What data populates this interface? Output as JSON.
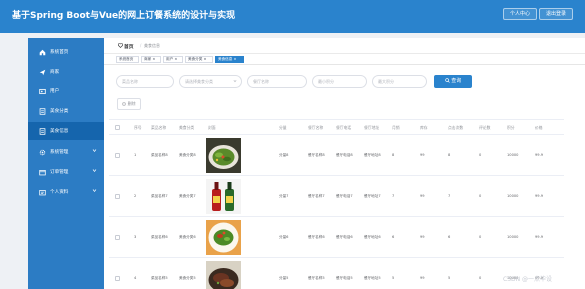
{
  "header": {
    "title": "基于Spring Boot与Vue的网上订餐系统的设计与实现",
    "center_label": "个人中心",
    "logout_label": "退出登录"
  },
  "sidebar": {
    "items": [
      {
        "label": "系统首页",
        "icon": "home-icon"
      },
      {
        "label": "商家",
        "icon": "send-icon"
      },
      {
        "label": "用户",
        "icon": "user-icon"
      },
      {
        "label": "美食分类",
        "icon": "list-icon"
      },
      {
        "label": "美食信息",
        "icon": "list-icon",
        "active": true
      },
      {
        "label": "系统管理",
        "icon": "gear-icon",
        "expandable": true
      },
      {
        "label": "订单管理",
        "icon": "cart-icon",
        "expandable": true
      },
      {
        "label": "个人资料",
        "icon": "card-icon",
        "expandable": true
      }
    ]
  },
  "breadcrumb": {
    "home": "首页",
    "separator": "/",
    "current": "美食信息"
  },
  "tags": [
    {
      "label": "系统首页"
    },
    {
      "label": "商家 ×"
    },
    {
      "label": "用户 ×"
    },
    {
      "label": "美食分类 ×"
    },
    {
      "label": "美食信息 ×",
      "active": true
    }
  ],
  "search": {
    "fields": [
      {
        "placeholder": "菜品名称"
      },
      {
        "placeholder": "请选择美食分类",
        "dropdown": true
      },
      {
        "placeholder": "餐厅名称"
      },
      {
        "placeholder": "最小积分"
      },
      {
        "placeholder": "最大积分"
      }
    ],
    "query_label": "查询"
  },
  "delete_label": "删除",
  "table": {
    "columns": [
      "序号",
      "菜品名称",
      "美食分类",
      "封面",
      "分量",
      "餐厅名称",
      "餐厅电话",
      "餐厅地址",
      "月销",
      "库存",
      "点击次数",
      "评论数",
      "积分",
      "价格"
    ],
    "rows": [
      {
        "cells": [
          "1",
          "菜品名称8",
          "美食分类8",
          "",
          "分量8",
          "餐厅名称8",
          "餐厅电话8",
          "餐厅地址8",
          "8",
          "99",
          "8",
          "0",
          "10000",
          "99.9"
        ],
        "image": "dish-greens"
      },
      {
        "cells": [
          "2",
          "菜品名称7",
          "美食分类7",
          "",
          "分量7",
          "餐厅名称7",
          "餐厅电话7",
          "餐厅地址7",
          "7",
          "99",
          "7",
          "0",
          "10000",
          "99.9"
        ],
        "image": "bottles"
      },
      {
        "cells": [
          "3",
          "菜品名称6",
          "美食分类6",
          "",
          "分量6",
          "餐厅名称6",
          "餐厅电话6",
          "餐厅地址6",
          "6",
          "99",
          "6",
          "0",
          "10000",
          "99.9"
        ],
        "image": "dish-plate"
      },
      {
        "cells": [
          "4",
          "菜品名称5",
          "美食分类5",
          "",
          "分量5",
          "餐厅名称5",
          "餐厅电话5",
          "餐厅地址5",
          "5",
          "99",
          "5",
          "0",
          "10000",
          "99.9"
        ],
        "image": "dish-meat"
      }
    ]
  },
  "watermark": "CSDN @一点毕设",
  "colors": {
    "header": "#2a83cd",
    "sidebar": "#2c7cc4",
    "sidebar_active": "#1565ad",
    "accent": "#2a83cd"
  }
}
